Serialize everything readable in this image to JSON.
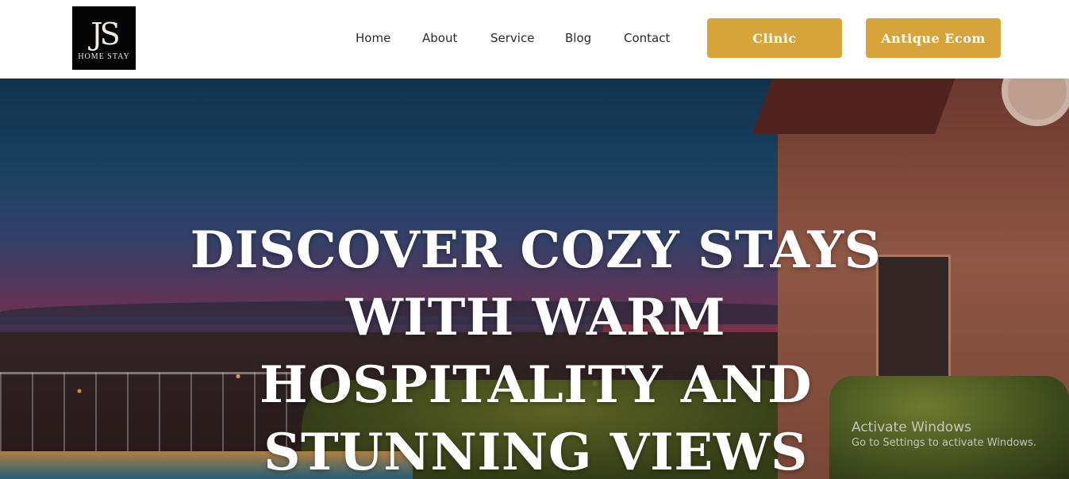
{
  "logo": {
    "mark": "JS",
    "subtitle": "HOME STAY"
  },
  "nav": {
    "items": [
      {
        "label": "Home"
      },
      {
        "label": "About"
      },
      {
        "label": "Service"
      },
      {
        "label": "Blog"
      },
      {
        "label": "Contact"
      }
    ]
  },
  "buttons": {
    "clinic": "Clinic",
    "antique_ecom": "Antique Ecom"
  },
  "hero": {
    "title": "DISCOVER COZY STAYS WITH WARM HOSPITALITY AND STUNNING VIEWS"
  },
  "watermark": {
    "title": "Activate Windows",
    "subtitle": "Go to Settings to activate Windows."
  },
  "colors": {
    "accent": "#d7a43c",
    "header_bg": "#ffffff",
    "nav_text": "#2b2b2b"
  }
}
